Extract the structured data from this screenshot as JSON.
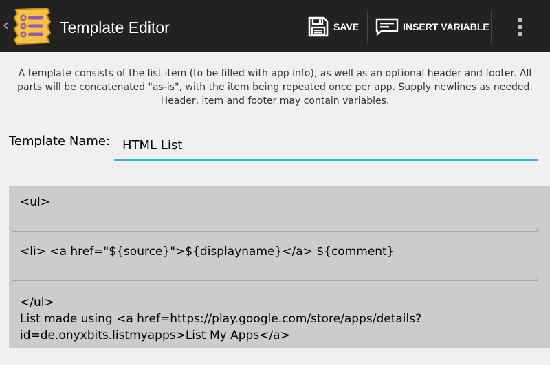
{
  "app_bar": {
    "title": "Template Editor",
    "up_glyph": "‹",
    "app_icon": "notepad-list-icon",
    "actions": {
      "save_label": "SAVE",
      "save_icon": "floppy-disk-icon",
      "insert_label": "INSERT VARIABLE",
      "insert_icon": "comment-box-icon",
      "overflow_icon": "overflow-menu-icon"
    },
    "colors": {
      "background": "#222222",
      "icon_fill": "#f5c242",
      "icon_lines": "#8e5bb5"
    }
  },
  "description": "A template consists of the list item (to be filled with app info), as well as an optional header and footer. All parts will be concatenated \"as-is\", with the item being repeated once per app. Supply newlines as needed. Header, item and footer may contain variables.",
  "template_name": {
    "label": "Template Name:",
    "value": "HTML List",
    "accent": "#33b5e5"
  },
  "sections": {
    "header": "<ul>",
    "item": "<li> <a href=\"${source}\">${displayname}</a> ${comment}",
    "footer": "</ul>\nList made using <a href=https://play.google.com/store/apps/details?\nid=de.onyxbits.listmyapps>List My Apps</a>"
  }
}
